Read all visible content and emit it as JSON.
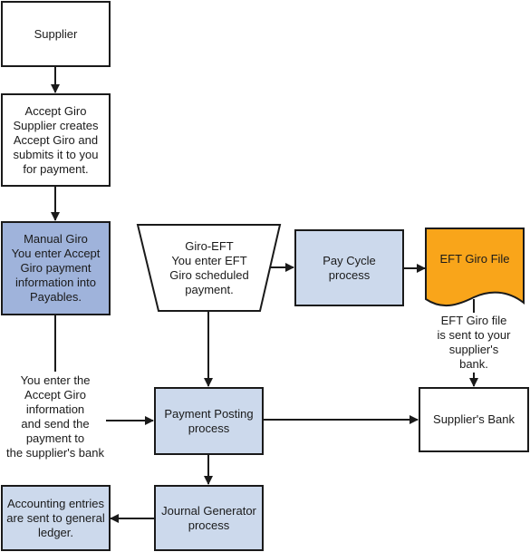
{
  "diagram": {
    "nodes": {
      "supplier": {
        "text": "Supplier"
      },
      "accept_giro": {
        "lines": [
          "Accept Giro",
          "Supplier creates",
          "Accept Giro and",
          "submits it to you",
          "for payment."
        ]
      },
      "manual_giro": {
        "lines": [
          "Manual Giro",
          "You enter Accept",
          "Giro payment",
          "information into",
          "Payables."
        ]
      },
      "giro_eft": {
        "lines": [
          "Giro-EFT",
          "You enter EFT",
          "Giro scheduled",
          "payment."
        ]
      },
      "pay_cycle": {
        "lines": [
          "Pay Cycle",
          "process"
        ]
      },
      "eft_giro_file": {
        "text": "EFT Giro File"
      },
      "payment_posting": {
        "lines": [
          "Payment Posting",
          "process"
        ]
      },
      "suppliers_bank": {
        "text": "Supplier's Bank"
      },
      "journal_generator": {
        "lines": [
          "Journal Generator",
          "process"
        ]
      },
      "accounting_entries": {
        "lines": [
          "Accounting entries",
          "are sent to general",
          "ledger."
        ]
      }
    },
    "labels": {
      "manual_to_posting": {
        "lines": [
          "You enter the",
          "Accept Giro",
          "information",
          "and send the",
          "payment to",
          "the supplier's bank"
        ]
      },
      "file_to_bank": {
        "lines": [
          "EFT Giro file",
          "is sent to your",
          "supplier's",
          "bank."
        ]
      }
    },
    "colors": {
      "manual_fill": "#9fb3db",
      "process_fill": "#ccd9ec",
      "file_fill": "#f9a51a",
      "stroke": "#1a1a1a"
    }
  }
}
